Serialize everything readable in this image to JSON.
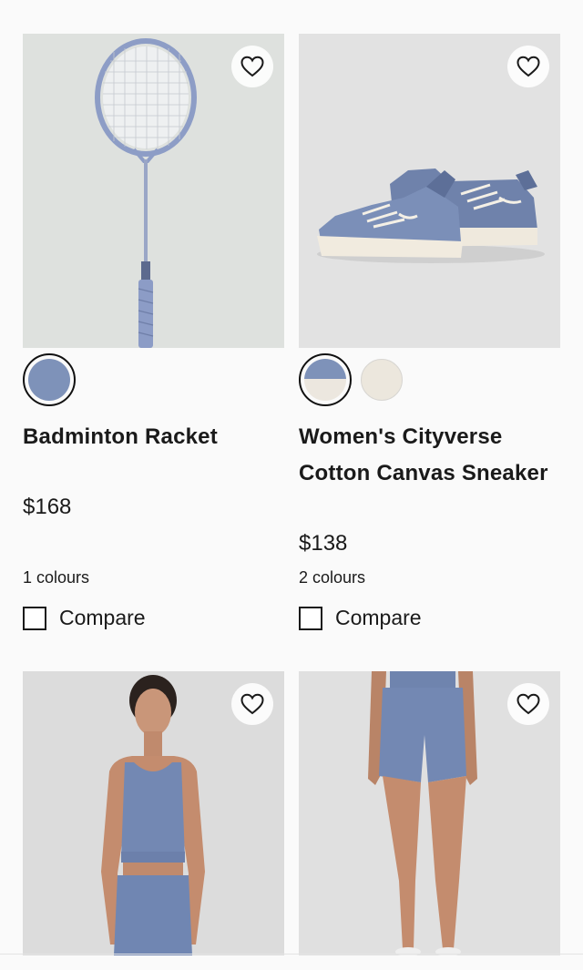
{
  "products": [
    {
      "title": "Badminton Racket",
      "price": "$168",
      "colours": "1 colours",
      "compare_label": "Compare",
      "swatches": [
        {
          "color": "#7e92b9",
          "selected": true
        }
      ]
    },
    {
      "title": "Women's Cityverse Cotton Canvas Sneaker",
      "price": "$138",
      "colours": "2 colours",
      "compare_label": "Compare",
      "swatches": [
        {
          "color_top": "#7e92b9",
          "color_bottom": "#ece7df",
          "selected": true
        },
        {
          "color": "#ece7dd",
          "selected": false
        }
      ]
    },
    {
      "title": "",
      "image": "model-tank-top"
    },
    {
      "title": "",
      "image": "model-shorts"
    }
  ],
  "icons": {
    "favorite": "heart-outline-icon"
  },
  "colors": {
    "product_blue": "#7e92b9",
    "text": "#1a1a1a",
    "image_bg": "#dcdcdc"
  }
}
